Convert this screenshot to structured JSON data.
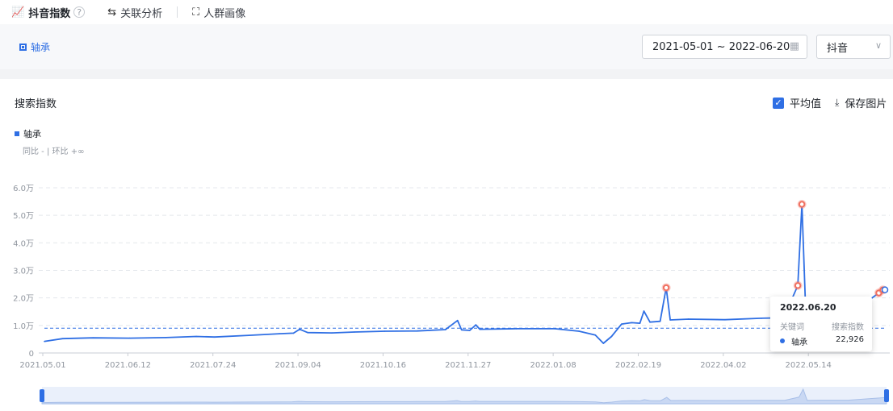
{
  "tabs": [
    {
      "label": "抖音指数",
      "icon": "trend-icon",
      "active": true,
      "help": "?"
    },
    {
      "label": "关联分析",
      "icon": "relation-icon",
      "active": false
    },
    {
      "label": "人群画像",
      "icon": "crowd-icon",
      "active": false
    }
  ],
  "filter": {
    "keyword": "轴承",
    "date_range": "2021-05-01 ~ 2022-06-20",
    "platform": "抖音"
  },
  "panel": {
    "title": "搜索指数",
    "average_label": "平均值",
    "average_checked": true,
    "save_label": "保存图片",
    "legend_label": "轴承",
    "compare_text": "同比 - | 环比 +∞"
  },
  "tooltip": {
    "date": "2022.06.20",
    "col_keyword": "关键词",
    "col_index": "搜索指数",
    "keyword": "轴承",
    "value": "22,926"
  },
  "colors": {
    "series": "#2f6fe4",
    "peak": "#f07060",
    "grid": "#e4e7ec"
  },
  "chart_data": {
    "type": "line",
    "x_start": "2021-05-01",
    "x_end": "2022-06-20",
    "xticks": [
      "2021.05.01",
      "2021.06.12",
      "2021.07.24",
      "2021.09.04",
      "2021.10.16",
      "2021.11.27",
      "2022.01.08",
      "2022.02.19",
      "2022.04.02",
      "2022.05.14"
    ],
    "yticks": [
      "0",
      "1.0万",
      "2.0万",
      "3.0万",
      "4.0万",
      "5.0万",
      "6.0万"
    ],
    "ylim": [
      0,
      60000
    ],
    "average": 9000,
    "grid": true,
    "series": [
      {
        "name": "轴承",
        "points": [
          [
            "2021-05-01",
            4200
          ],
          [
            "2021-05-10",
            5200
          ],
          [
            "2021-05-25",
            5500
          ],
          [
            "2021-06-12",
            5400
          ],
          [
            "2021-06-30",
            5600
          ],
          [
            "2021-07-15",
            6000
          ],
          [
            "2021-07-24",
            5800
          ],
          [
            "2021-08-10",
            6400
          ],
          [
            "2021-08-25",
            7000
          ],
          [
            "2021-09-01",
            7200
          ],
          [
            "2021-09-04",
            8600
          ],
          [
            "2021-09-08",
            7400
          ],
          [
            "2021-09-20",
            7300
          ],
          [
            "2021-10-01",
            7600
          ],
          [
            "2021-10-16",
            7900
          ],
          [
            "2021-11-01",
            8000
          ],
          [
            "2021-11-15",
            8500
          ],
          [
            "2021-11-21",
            11800
          ],
          [
            "2021-11-23",
            8400
          ],
          [
            "2021-11-27",
            8200
          ],
          [
            "2021-11-30",
            10200
          ],
          [
            "2021-12-02",
            8600
          ],
          [
            "2021-12-20",
            8800
          ],
          [
            "2022-01-08",
            8800
          ],
          [
            "2022-01-20",
            7900
          ],
          [
            "2022-01-28",
            6500
          ],
          [
            "2022-02-01",
            3500
          ],
          [
            "2022-02-05",
            6000
          ],
          [
            "2022-02-10",
            10500
          ],
          [
            "2022-02-15",
            11000
          ],
          [
            "2022-02-19",
            10800
          ],
          [
            "2022-02-21",
            15200
          ],
          [
            "2022-02-24",
            11200
          ],
          [
            "2022-03-01",
            11500
          ],
          [
            "2022-03-04",
            23700
          ],
          [
            "2022-03-06",
            12000
          ],
          [
            "2022-03-15",
            12300
          ],
          [
            "2022-04-02",
            12100
          ],
          [
            "2022-04-20",
            12600
          ],
          [
            "2022-05-01",
            12800
          ],
          [
            "2022-05-08",
            24500
          ],
          [
            "2022-05-10",
            54000
          ],
          [
            "2022-05-12",
            12500
          ],
          [
            "2022-05-14",
            12800
          ],
          [
            "2022-06-01",
            13200
          ],
          [
            "2022-06-17",
            21800
          ],
          [
            "2022-06-19",
            22900
          ],
          [
            "2022-06-20",
            22926
          ]
        ],
        "peaks": [
          "2022-03-04",
          "2022-05-08",
          "2022-05-10",
          "2022-06-17",
          "2022-06-19"
        ]
      }
    ]
  }
}
